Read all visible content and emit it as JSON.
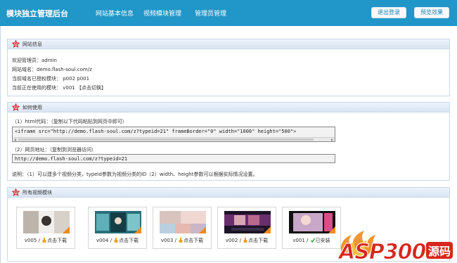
{
  "header": {
    "brand": "模块独立管理后台",
    "nav": [
      "网站基本信息",
      "视频模块管理",
      "管理员管理"
    ],
    "logout": "退出登录",
    "preview": "预览效果"
  },
  "site_info": {
    "title": "网站信息",
    "lines": [
      "欢迎管理员：admin",
      "网站域名：demo.flash-soul.com/z",
      "当前域名已授权模块： p002 p001",
      "当前正在使用的模块： v001 【点击切换】"
    ]
  },
  "usage": {
    "title": "如何使用",
    "html_label": "（1）html代码：（复制以下代码粘贴到网页中即可）",
    "html_code": "<iframe src=\"http://demo.flash-soul.com/z?typeid=21\" frameBorder=\"0\" width=\"1000\" height=\"500\">",
    "url_label": "（2）网页地址：（复制到浏览器访问）",
    "url_value": "http://demo.flash-soul.com/z?typeid=21",
    "note": "说明：（1）可以建多个视频分类，typeid参数为视频分类的ID（2）width、height参数可以根据实际情况设置。"
  },
  "modules": {
    "title": "所有视频模块",
    "items": [
      {
        "id": "v005",
        "action": "点击下载",
        "status": "download"
      },
      {
        "id": "v004",
        "action": "点击下载",
        "status": "download"
      },
      {
        "id": "v003",
        "action": "点击下载",
        "status": "download"
      },
      {
        "id": "v002",
        "action": "点击下载",
        "status": "download"
      },
      {
        "id": "v001",
        "action": "已安装",
        "status": "installed"
      }
    ],
    "sep": "/"
  },
  "watermark": {
    "brand": "ASP300",
    "suffix": "源码"
  },
  "colors": {
    "topbar": "#2196c8",
    "section_head": "#dde7f4",
    "download_icon": "#f0a020",
    "installed_icon": "#2ea043",
    "watermark_red": "#d8261c"
  }
}
